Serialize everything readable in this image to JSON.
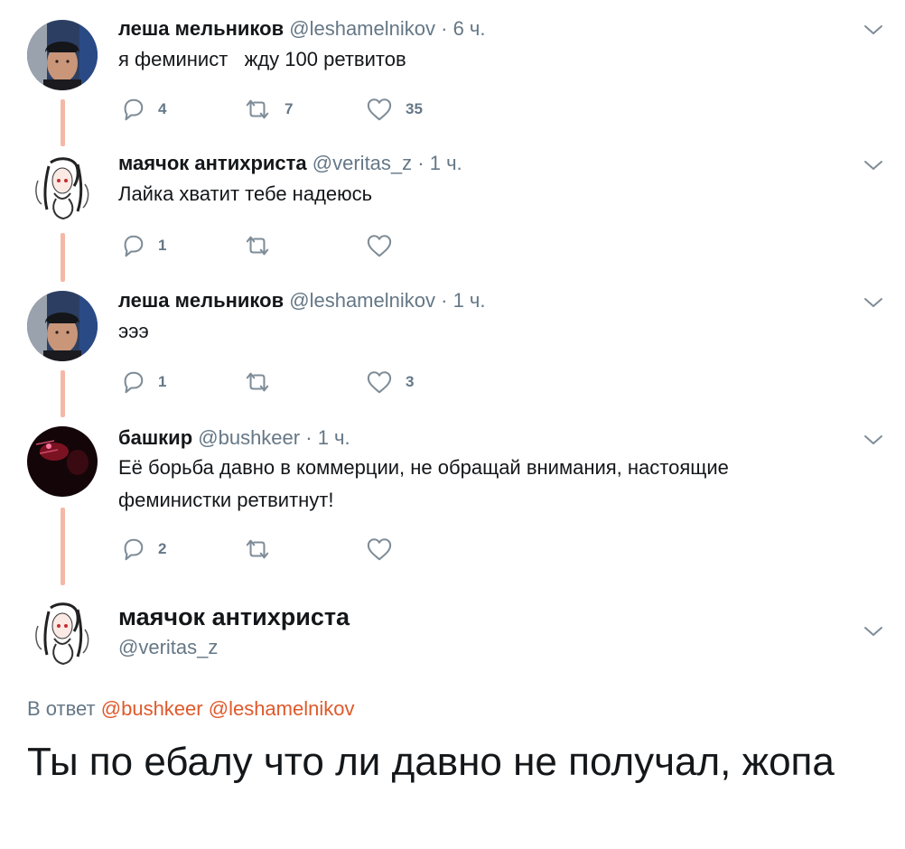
{
  "tweets": [
    {
      "display_name": "леша мельников",
      "handle": "@leshamelnikov",
      "separator": "·",
      "time": "6 ч.",
      "text": "я феминист   жду 100 ретвитов",
      "replies": "4",
      "retweets": "7",
      "likes": "35",
      "avatar_icon": "user-photo-avatar"
    },
    {
      "display_name": "маячок антихриста",
      "handle": "@veritas_z",
      "separator": "·",
      "time": "1 ч.",
      "text": "Лайка хватит тебе надеюсь",
      "replies": "1",
      "retweets": "",
      "likes": "",
      "avatar_icon": "drawing-avatar"
    },
    {
      "display_name": "леша мельников",
      "handle": "@leshamelnikov",
      "separator": "·",
      "time": "1 ч.",
      "text": "эээ",
      "replies": "1",
      "retweets": "",
      "likes": "3",
      "avatar_icon": "user-photo-avatar"
    },
    {
      "display_name": "башкир",
      "handle": "@bushkeer",
      "separator": "·",
      "time": "1 ч.",
      "text": "Её борьба давно в коммерции, не обращай внимания, настоящие феминистки ретвитнут!",
      "replies": "2",
      "retweets": "",
      "likes": "",
      "avatar_icon": "dark-red-photo-avatar"
    }
  ],
  "main_tweet": {
    "display_name": "маячок антихриста",
    "handle": "@veritas_z",
    "reply_prefix": "В ответ",
    "mentions": [
      "@bushkeer",
      "@leshamelnikov"
    ],
    "text": "Ты по ебалу что ли давно не получал, жопа"
  },
  "icons": {
    "reply": "reply-icon",
    "retweet": "retweet-icon",
    "like": "heart-icon",
    "caret": "chevron-down-icon"
  },
  "colors": {
    "thread_line": "#f5b8a6",
    "mention": "#e0592a",
    "secondary_text": "#657786",
    "primary_text": "#14171a"
  }
}
